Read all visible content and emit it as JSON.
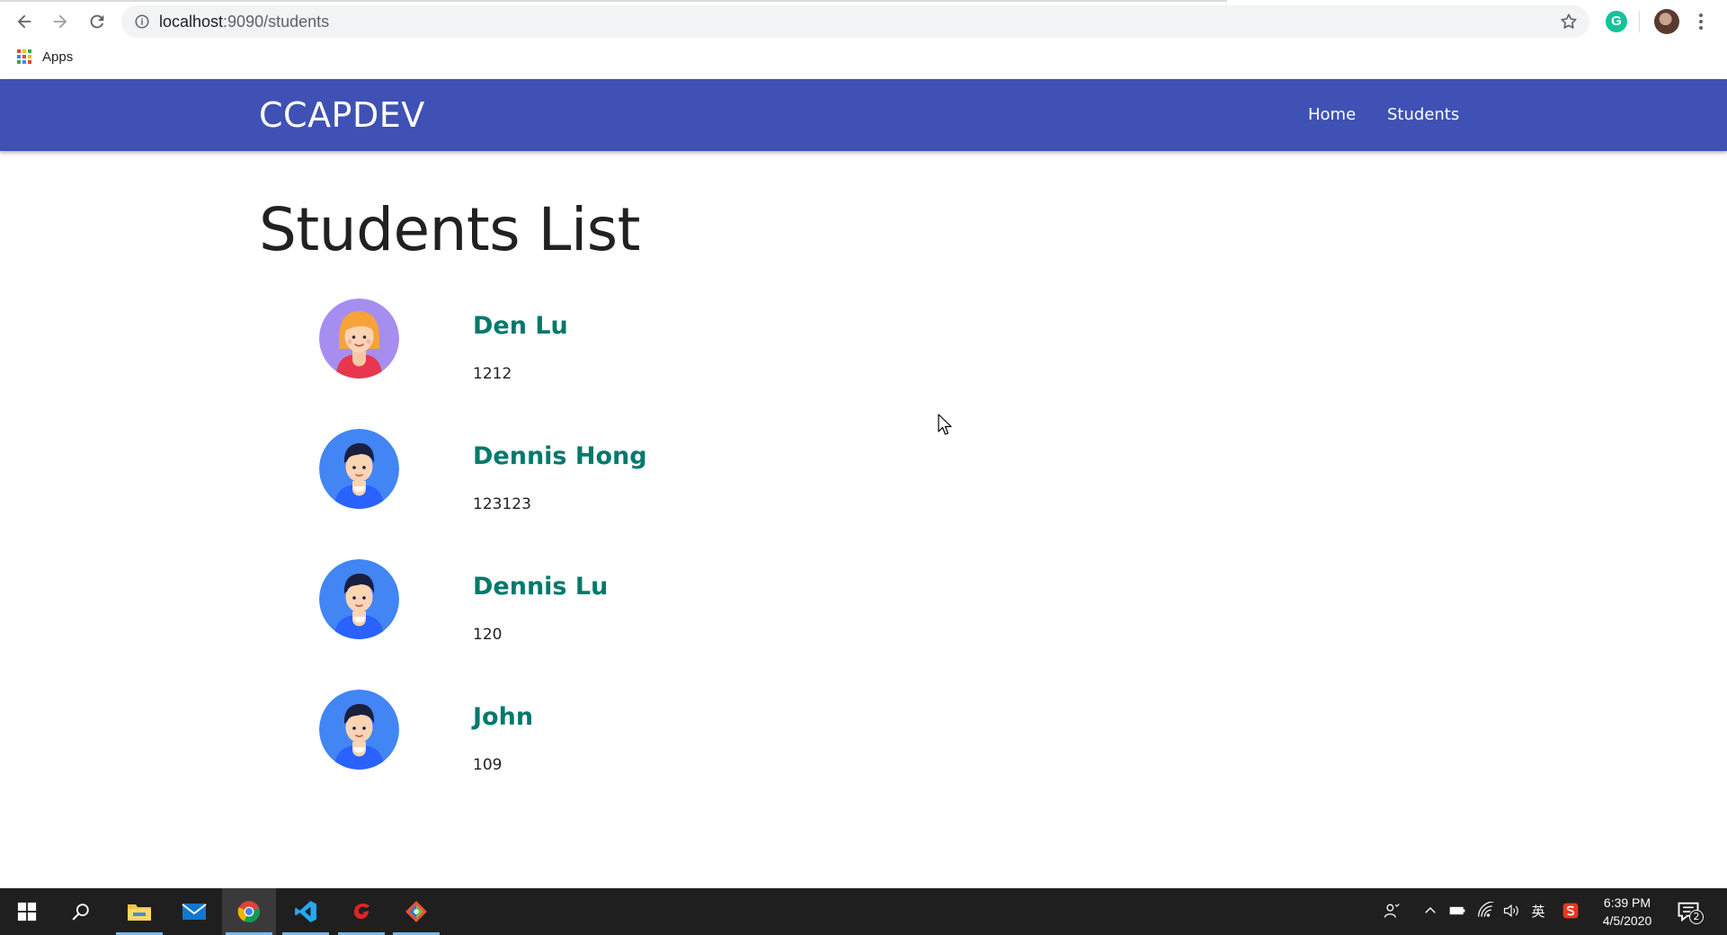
{
  "browser": {
    "url_host": "localhost",
    "url_rest": ":9090/students",
    "bookmark_apps_label": "Apps",
    "extension_letter": "G"
  },
  "site": {
    "brand": "CCAPDEV",
    "nav": [
      {
        "label": "Home"
      },
      {
        "label": "Students"
      }
    ]
  },
  "page": {
    "title": "Students List"
  },
  "students": [
    {
      "name": "Den Lu",
      "id": "1212",
      "avatar": "female-avatar"
    },
    {
      "name": "Dennis Hong",
      "id": "123123",
      "avatar": "male-avatar"
    },
    {
      "name": "Dennis Lu",
      "id": "120",
      "avatar": "male-avatar"
    },
    {
      "name": "John",
      "id": "109",
      "avatar": "male-avatar"
    }
  ],
  "taskbar": {
    "apps": [
      "start-icon",
      "search-icon",
      "file-explorer-icon",
      "mail-icon",
      "chrome-icon",
      "vscode-icon",
      "app-red-icon",
      "sourcetree-icon"
    ],
    "ime_label": "英",
    "time": "6:39 PM",
    "date": "4/5/2020",
    "notification_count": "2"
  },
  "colors": {
    "navbar": "#3f51b5",
    "student_name": "#00796b",
    "female_avatar_bg": "#a58ef0",
    "male_avatar_bg": "#4285f4"
  }
}
